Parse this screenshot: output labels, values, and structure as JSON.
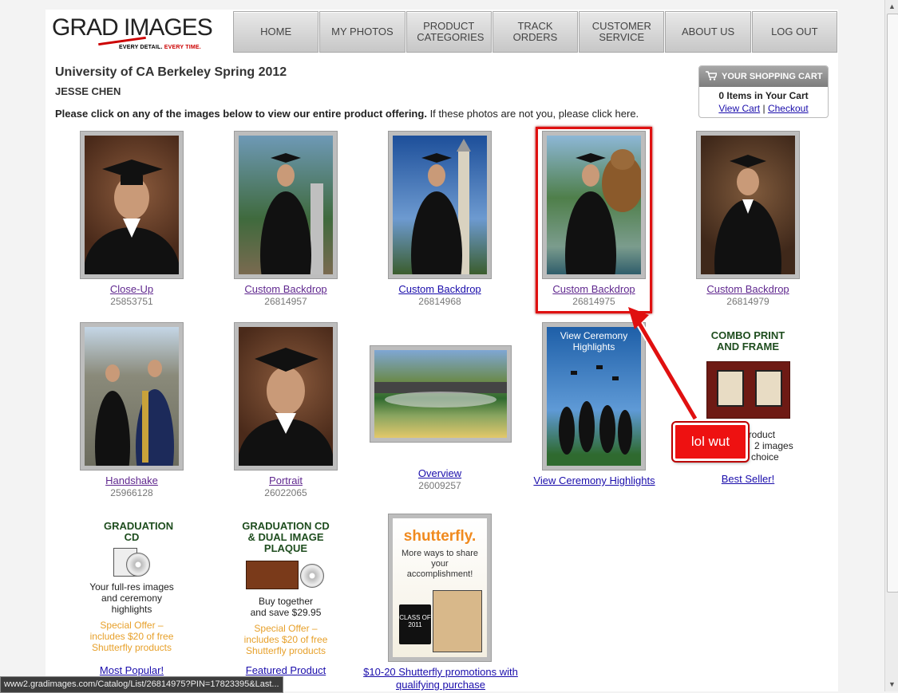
{
  "brand": {
    "logo_text": "GRAD IMAGES",
    "tagline_a": "EVERY DETAIL.",
    "tagline_b": "EVERY TIME."
  },
  "nav": [
    {
      "label": "HOME"
    },
    {
      "label": "MY PHOTOS"
    },
    {
      "label": "PRODUCT CATEGORIES"
    },
    {
      "label": "TRACK ORDERS"
    },
    {
      "label": "CUSTOMER SERVICE"
    },
    {
      "label": "ABOUT US"
    },
    {
      "label": "LOG OUT"
    }
  ],
  "heading": {
    "title": "University of CA Berkeley Spring 2012",
    "name": "JESSE CHEN",
    "instruction_bold": "Please click on any of the images below to view our entire product offering.",
    "instruction_rest": "If these photos are not you, please click here."
  },
  "cart": {
    "header": "YOUR SHOPPING CART",
    "items": "0 Items in Your Cart",
    "view_cart": "View Cart",
    "sep": "|",
    "checkout": "Checkout"
  },
  "photos": [
    {
      "caption": "Close-Up",
      "number": "25853751",
      "icon": "portrait-photo"
    },
    {
      "caption": "Custom Backdrop",
      "number": "26814957",
      "icon": "campus-gate-photo"
    },
    {
      "caption": "Custom Backdrop",
      "number": "26814968",
      "icon": "campanile-photo"
    },
    {
      "caption": "Custom Backdrop",
      "number": "26814975",
      "icon": "bear-backdrop-photo"
    },
    {
      "caption": "Custom Backdrop",
      "number": "26814979",
      "icon": "portrait-photo"
    },
    {
      "caption": "Handshake",
      "number": "25966128",
      "icon": "handshake-photo"
    },
    {
      "caption": "Portrait",
      "number": "26022065",
      "icon": "portrait-photo"
    },
    {
      "caption": "Overview",
      "number": "26009257",
      "icon": "stadium-photo"
    }
  ],
  "ceremony": {
    "caption": "View Ceremony Highlights",
    "image_text": "View Ceremony Highlights"
  },
  "combo": {
    "title": "COMBO PRINT AND FRAME",
    "text_a": "product",
    "text_b": "2 images",
    "text_c": "choice",
    "caption": "Best Seller!"
  },
  "grad_cd": {
    "title": "GRADUATION CD",
    "text": "Your full-res images and ceremony highlights",
    "offer": "Special Offer – includes $20 of free Shutterfly products",
    "caption": "Most Popular!"
  },
  "grad_cd_plaque": {
    "title": "GRADUATION CD & DUAL IMAGE PLAQUE",
    "text": "Buy together and save $29.95",
    "offer": "Special Offer – includes $20 of free Shutterfly products",
    "caption": "Featured Product"
  },
  "shutterfly": {
    "logo": "shutterfly.",
    "text": "More ways to share your accomplishment!",
    "mug_text": "CLASS OF 2011",
    "caption": "$10-20 Shutterfly promotions with qualifying purchase"
  },
  "annotation": {
    "note": "lol wut"
  },
  "status_bar": "www2.gradimages.com/Catalog/List/26814975?PIN=17823395&Last...",
  "colors": {
    "link": "#1a0dab",
    "visited": "#60288f",
    "highlight": "#e01010"
  }
}
